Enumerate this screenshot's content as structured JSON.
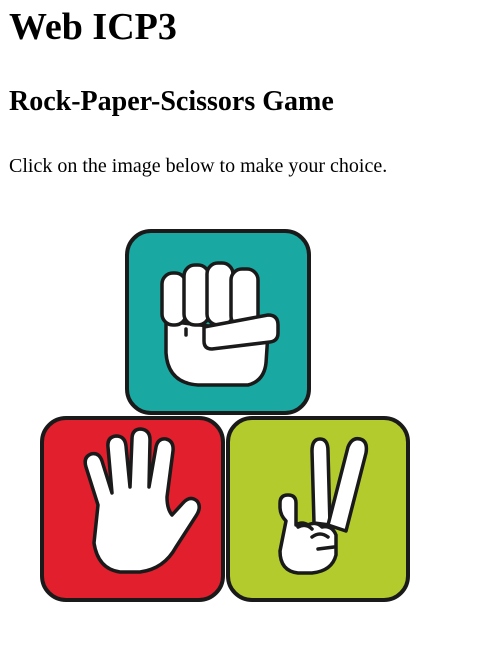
{
  "page": {
    "title": "Web ICP3",
    "subtitle": "Rock-Paper-Scissors Game",
    "instructions": "Click on the image below to make your choice."
  },
  "choices": [
    {
      "id": "rock",
      "icon": "fist-icon",
      "color": "#1aa9a2"
    },
    {
      "id": "paper",
      "icon": "open-hand-icon",
      "color": "#e11f2d"
    },
    {
      "id": "scissors",
      "icon": "peace-sign-icon",
      "color": "#b3cb2d"
    }
  ],
  "colors": {
    "outline": "#1a1a1a",
    "hand_fill": "#ffffff"
  }
}
